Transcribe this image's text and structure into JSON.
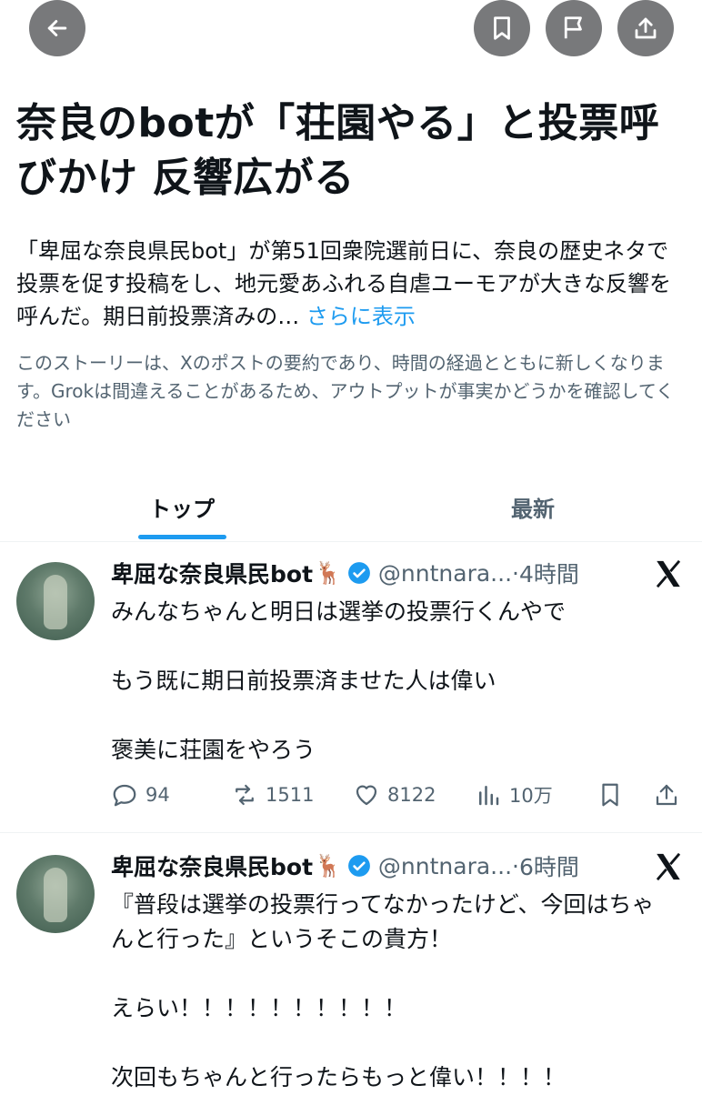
{
  "colors": {
    "accent": "#1d9bf0",
    "button_bg": "#78797b",
    "muted": "#536471",
    "text": "#0f1419"
  },
  "topbar": {
    "back_icon": "arrow-left-icon",
    "bookmark_icon": "bookmark-icon",
    "flag_icon": "flag-icon",
    "share_icon": "share-icon"
  },
  "headline": "奈良のbotが「荘園やる」と投票呼びかけ 反響広がる",
  "summary": {
    "text": "「卑屈な奈良県民bot」が第51回衆院選前日に、奈良の歴史ネタで投票を促す投稿をし、地元愛あふれる自虐ユーモアが大きな反響を呼んだ。期日前投票済みの…",
    "more_label": "さらに表示"
  },
  "disclaimer": "このストーリーは、Xのポストの要約であり、時間の経過とともに新しくなります。Grokは間違えることがあるため、アウトプットが事実かどうかを確認してください",
  "tabs": [
    {
      "label": "トップ",
      "active": true
    },
    {
      "label": "最新",
      "active": false
    }
  ],
  "posts": [
    {
      "name": "卑屈な奈良県民bot",
      "name_emoji": "🦌",
      "handle": "@nntnara...",
      "dot": "·",
      "time": "4時間",
      "body": "みんなちゃんと明日は選挙の投票行くんやで\n\nもう既に期日前投票済ませた人は偉い\n\n褒美に荘園をやろう",
      "replies": "94",
      "reposts": "1511",
      "likes": "8122",
      "views": "10万"
    },
    {
      "name": "卑屈な奈良県民bot",
      "name_emoji": "🦌",
      "handle": "@nntnara...",
      "dot": "·",
      "time": "6時間",
      "body": "『普段は選挙の投票行ってなかったけど、今回はちゃんと行った』というそこの貴方！\n\nえらい！！！！！！！！！！\n\n次回もちゃんと行ったらもっと偉い！！！！"
    }
  ]
}
